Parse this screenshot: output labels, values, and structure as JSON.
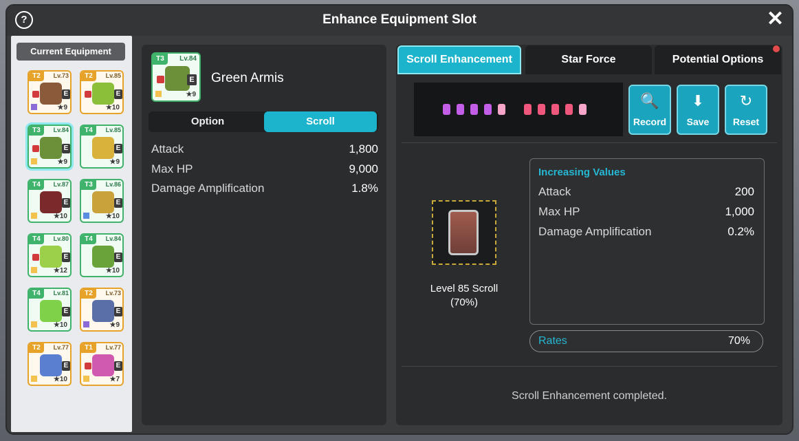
{
  "dialog": {
    "title": "Enhance Equipment Slot",
    "help_label": "?",
    "close_label": "✕"
  },
  "sidebar": {
    "header": "Current Equipment",
    "slots": [
      {
        "tier": "T2",
        "level": "Lv.73",
        "stars": "9",
        "color": "orange",
        "selected": false,
        "locked": true,
        "sq": "purple",
        "art": "#8a5a3a"
      },
      {
        "tier": "T2",
        "level": "Lv.85",
        "stars": "10",
        "color": "orange",
        "selected": false,
        "locked": true,
        "sq": "",
        "art": "#8bbf3a"
      },
      {
        "tier": "T3",
        "level": "Lv.84",
        "stars": "9",
        "color": "green",
        "selected": true,
        "locked": true,
        "sq": "yellow",
        "art": "#6c8f3a"
      },
      {
        "tier": "T4",
        "level": "Lv.85",
        "stars": "9",
        "color": "green",
        "selected": false,
        "locked": false,
        "sq": "",
        "art": "#d8b23a"
      },
      {
        "tier": "T4",
        "level": "Lv.87",
        "stars": "10",
        "color": "green",
        "selected": false,
        "locked": false,
        "sq": "yellow",
        "art": "#7a2a2a"
      },
      {
        "tier": "T3",
        "level": "Lv.86",
        "stars": "10",
        "color": "green",
        "selected": false,
        "locked": false,
        "sq": "blue",
        "art": "#c9a23a"
      },
      {
        "tier": "T4",
        "level": "Lv.80",
        "stars": "12",
        "color": "green",
        "selected": false,
        "locked": true,
        "sq": "yellow",
        "art": "#9ccf4a"
      },
      {
        "tier": "T4",
        "level": "Lv.84",
        "stars": "10",
        "color": "green",
        "selected": false,
        "locked": false,
        "sq": "",
        "art": "#6aa33a"
      },
      {
        "tier": "T4",
        "level": "Lv.81",
        "stars": "10",
        "color": "green",
        "selected": false,
        "locked": false,
        "sq": "yellow",
        "art": "#7fd14a"
      },
      {
        "tier": "T2",
        "level": "Lv.73",
        "stars": "9",
        "color": "orange",
        "selected": false,
        "locked": false,
        "sq": "purple",
        "art": "#5a6fa8"
      },
      {
        "tier": "T2",
        "level": "Lv.77",
        "stars": "10",
        "color": "orange",
        "selected": false,
        "locked": false,
        "sq": "yellow",
        "art": "#5a7fd0"
      },
      {
        "tier": "T1",
        "level": "Lv.77",
        "stars": "7",
        "color": "orange",
        "selected": false,
        "locked": true,
        "sq": "yellow",
        "art": "#d05ab0"
      }
    ],
    "equip_badge": "E"
  },
  "item": {
    "tier": "T3",
    "level": "Lv.84",
    "stars": "9",
    "name": "Green Armis",
    "equip_badge": "E"
  },
  "detail_tabs": {
    "option_label": "Option",
    "scroll_label": "Scroll"
  },
  "stats": [
    {
      "name": "Attack",
      "value": "1,800"
    },
    {
      "name": "Max HP",
      "value": "9,000"
    },
    {
      "name": "Damage Amplification",
      "value": "1.8%"
    }
  ],
  "tabs": {
    "scroll_enhancement": "Scroll Enhancement",
    "star_force": "Star Force",
    "potential_options": "Potential Options"
  },
  "actions": {
    "record": "Record",
    "save": "Save",
    "reset": "Reset"
  },
  "scroll": {
    "name": "Level 85 Scroll",
    "rate": "(70%)"
  },
  "increasing": {
    "title": "Increasing Values",
    "rows": [
      {
        "name": "Attack",
        "value": "200"
      },
      {
        "name": "Max HP",
        "value": "1,000"
      },
      {
        "name": "Damage Amplification",
        "value": "0.2%"
      }
    ]
  },
  "rates": {
    "label": "Rates",
    "value": "70%"
  },
  "status": "Scroll Enhancement completed.",
  "colors": {
    "accent": "#1cb3cc",
    "accent_text": "#25b7d3",
    "tier_green": "#3fb36b",
    "tier_orange": "#e7a22a",
    "scroll_glyph_purple": "#c35ee8",
    "scroll_glyph_pink": "#f0577c"
  }
}
